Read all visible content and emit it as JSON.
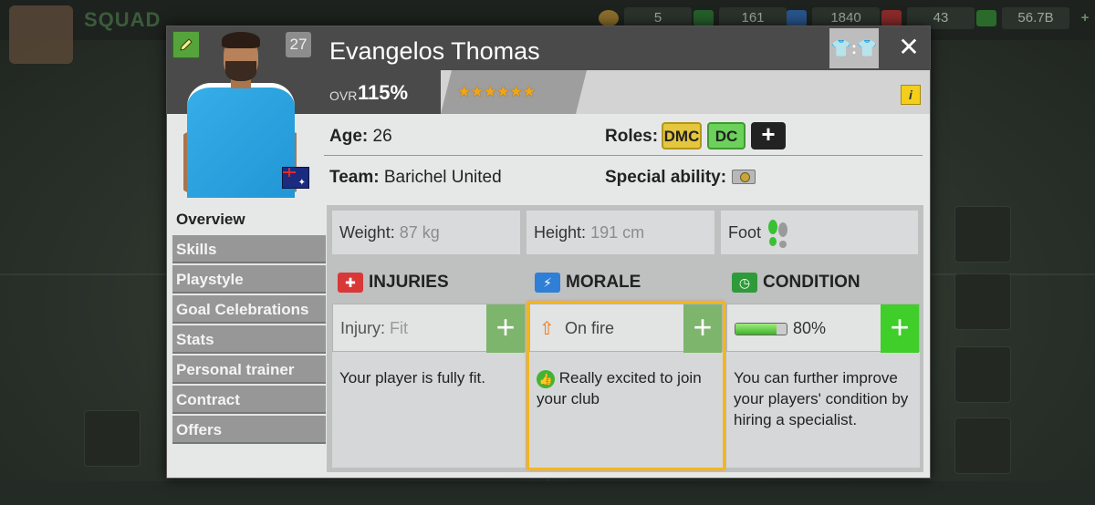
{
  "background": {
    "squad_title": "SQUAD",
    "resources": [
      {
        "name": "tokens",
        "value": "5",
        "icon": "token-icon",
        "color": "#d0a036"
      },
      {
        "name": "scout",
        "value": "161",
        "icon": "clock-icon",
        "color": "#2f9a3a"
      },
      {
        "name": "energy",
        "value": "1840",
        "icon": "lightning-icon",
        "color": "#2f7fd6"
      },
      {
        "name": "medical",
        "value": "43",
        "icon": "medical-cross-icon",
        "color": "#d93838"
      },
      {
        "name": "cash",
        "value": "56.7B",
        "icon": "money-icon",
        "color": "#3a9a3a"
      }
    ],
    "plus_label": "+"
  },
  "player": {
    "number": "27",
    "name": "Evangelos Thomas",
    "ovr_label": "OVR",
    "ovr_value": "115%",
    "stars": "★★★★★★",
    "star_rating": 6,
    "flag": "australia-flag-icon"
  },
  "header": {
    "kit_label": "👕:👕",
    "close_label": "✕",
    "info_label": "i"
  },
  "details": {
    "age_label": "Age:",
    "age_value": "26",
    "team_label": "Team:",
    "team_value": "Barichel United",
    "roles_label": "Roles:",
    "roles": [
      "DMC",
      "DC"
    ],
    "add_role_label": "+",
    "special_label": "Special ability:"
  },
  "menu": [
    "Overview",
    "Skills",
    "Playstyle",
    "Goal Celebrations",
    "Stats",
    "Personal trainer",
    "Contract",
    "Offers"
  ],
  "overview": {
    "weight_label": "Weight:",
    "weight_value": "87 kg",
    "height_label": "Height:",
    "height_value": "191 cm",
    "foot_label": "Foot",
    "injuries": {
      "title": "INJURIES",
      "bar_label": "Injury:",
      "bar_value": "Fit",
      "text": "Your player is fully fit.",
      "icon_color": "#d93838"
    },
    "morale": {
      "title": "MORALE",
      "bar_value": "On fire",
      "text": "Really excited to join your club",
      "icon_color": "#2f7fd6"
    },
    "condition": {
      "title": "CONDITION",
      "bar_value": "80%",
      "level": 0.8,
      "text": "You can further improve your players' condition by hiring a specialist.",
      "icon_color": "#2f9a3a"
    },
    "plus_label": "+"
  }
}
